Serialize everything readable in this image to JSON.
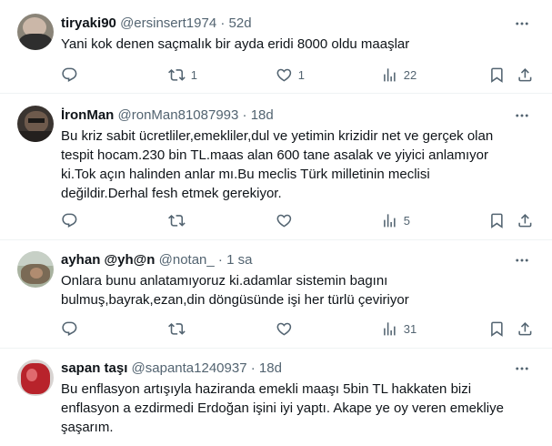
{
  "tweets": [
    {
      "name": "tiryaki90",
      "handle": "@ersinsert1974",
      "sep": "·",
      "time": "52d",
      "text": "Yani kok denen saçmalık bir ayda eridi 8000 oldu maaşlar",
      "retweets": "1",
      "likes": "1",
      "views": "22",
      "replies": ""
    },
    {
      "name": "İronMan",
      "handle": "@ronMan81087993",
      "sep": "·",
      "time": "18d",
      "text": "Bu kriz sabit ücretliler,emekliler,dul ve yetimin krizidir net ve gerçek olan\ntespit hocam.230 bin TL.maas alan 600 tane asalak ve yiyici anlamıyor\nki.Tok açın halinden anlar mı.Bu meclis Türk milletinin meclisi\ndeğildir.Derhal fesh etmek gerekiyor.",
      "retweets": "",
      "likes": "",
      "views": "5",
      "replies": ""
    },
    {
      "name": "ayhan @yh@n",
      "handle": "@notan_",
      "sep": "·",
      "time": "1 sa",
      "text": "Onlara bunu anlatamıyoruz ki.adamlar sistemin bagını\nbulmuş,bayrak,ezan,din döngüsünde işi her türlü çeviriyor",
      "retweets": "",
      "likes": "",
      "views": "31",
      "replies": ""
    },
    {
      "name": "sapan taşı",
      "handle": "@sapanta1240937",
      "sep": "·",
      "time": "18d",
      "text": "Bu enflasyon artışıyla haziranda emekli maaşı 5bin TL hakkaten bizi\nenflasyon a ezdirmedi Erdoğan işini iyi yaptı.  Akape ye oy veren emekliye\nşaşarım.",
      "retweets": "",
      "likes": "",
      "views": "",
      "replies": ""
    }
  ],
  "icons": {
    "reply": "reply-icon",
    "retweet": "retweet-icon",
    "like": "like-icon",
    "views": "views-icon",
    "bookmark": "bookmark-icon",
    "share": "share-icon",
    "more": "more-icon"
  },
  "colors": {
    "text": "#0f1419",
    "secondary": "#536471",
    "divider": "#eff3f4"
  }
}
